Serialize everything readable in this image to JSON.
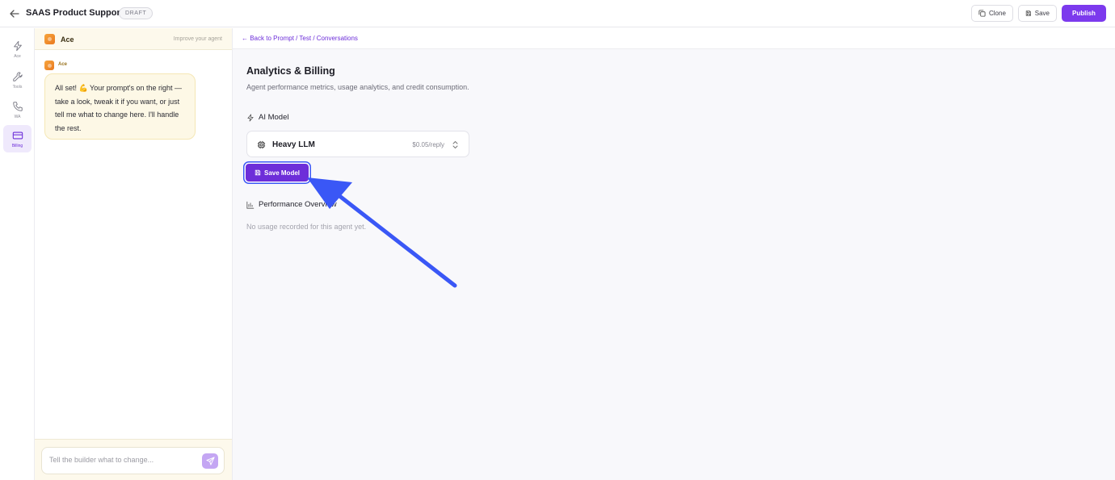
{
  "topbar": {
    "title": "SAAS Product Support",
    "status_badge": "DRAFT",
    "clone_label": "Clone",
    "save_label": "Save",
    "publish_label": "Publish"
  },
  "rail": {
    "items": [
      {
        "label": "Ace",
        "icon": "bolt-icon"
      },
      {
        "label": "Tools",
        "icon": "wrench-icon"
      },
      {
        "label": "WA",
        "icon": "phone-icon"
      },
      {
        "label": "Billing",
        "icon": "credit-card-icon",
        "active": true
      }
    ]
  },
  "chat": {
    "agent_name": "Ace",
    "improve_link": "Improve your agent",
    "message_author": "Ace",
    "message_text": "All set! 💪 Your prompt's on the right — take a look, tweak it if you want, or just tell me what to change here. I'll handle the rest.",
    "composer_placeholder": "Tell the builder what to change..."
  },
  "main": {
    "back_link": "← Back to Prompt / Test / Conversations",
    "title": "Analytics & Billing",
    "subtitle": "Agent performance metrics, usage analytics, and credit consumption.",
    "ai_model_heading": "AI Model",
    "model_name": "Heavy LLM",
    "model_price": "$0.05/reply",
    "save_model_label": "Save Model",
    "performance_heading": "Performance Overview",
    "empty_state": "No usage recorded for this agent yet."
  },
  "colors": {
    "accent": "#7c3aed",
    "annotation_arrow": "#3a57f6"
  }
}
